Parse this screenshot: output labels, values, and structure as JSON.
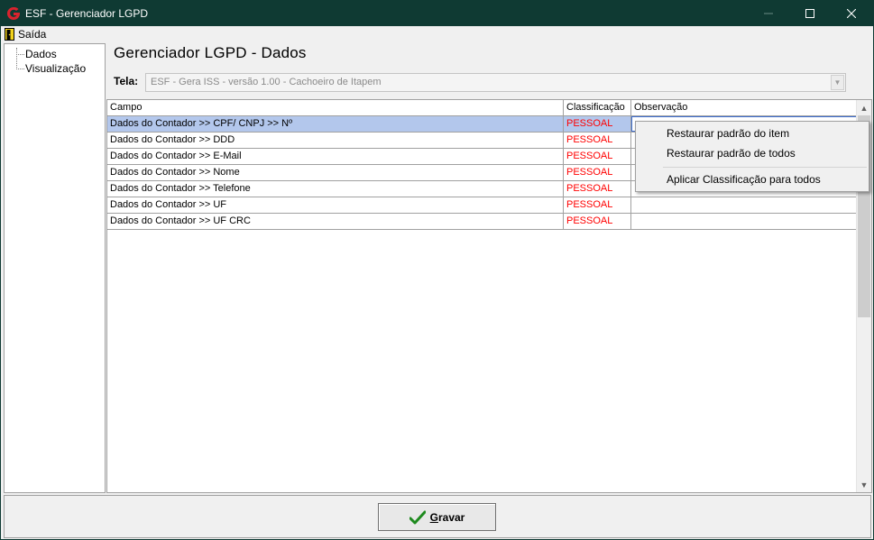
{
  "window": {
    "title": "ESF - Gerenciador LGPD",
    "controls": {
      "minimize": "—",
      "maximize": "☐",
      "close": "✕"
    }
  },
  "menu": {
    "saida": "Saída"
  },
  "tree": {
    "items": [
      {
        "label": "Dados"
      },
      {
        "label": "Visualização"
      }
    ]
  },
  "page": {
    "title": "Gerenciador LGPD - Dados",
    "tela_label": "Tela:",
    "tela_value": "ESF - Gera ISS - versão 1.00 - Cachoeiro de Itapem"
  },
  "grid": {
    "columns": [
      "Campo",
      "Classificação",
      "Observação"
    ],
    "rows": [
      {
        "campo": "Dados do Contador >> CPF/ CNPJ >> Nº",
        "classificacao": "PESSOAL",
        "observacao": ""
      },
      {
        "campo": "Dados do Contador >> DDD",
        "classificacao": "PESSOAL",
        "observacao": ""
      },
      {
        "campo": "Dados do Contador >> E-Mail",
        "classificacao": "PESSOAL",
        "observacao": ""
      },
      {
        "campo": "Dados do Contador >> Nome",
        "classificacao": "PESSOAL",
        "observacao": ""
      },
      {
        "campo": "Dados do Contador >> Telefone",
        "classificacao": "PESSOAL",
        "observacao": ""
      },
      {
        "campo": "Dados do Contador >> UF",
        "classificacao": "PESSOAL",
        "observacao": ""
      },
      {
        "campo": "Dados do Contador >> UF CRC",
        "classificacao": "PESSOAL",
        "observacao": ""
      }
    ],
    "selected_row": 0
  },
  "context_menu": {
    "items": [
      "Restaurar padrão do item",
      "Restaurar padrão de todos",
      "Aplicar Classificação para todos"
    ]
  },
  "footer": {
    "gravar_prefix": "G",
    "gravar_rest": "ravar"
  },
  "colors": {
    "titlebar": "#0f3a33",
    "classificacao_text": "#ff0000",
    "selection": "#b3c7ec",
    "accent_icon": "#d9232e"
  }
}
